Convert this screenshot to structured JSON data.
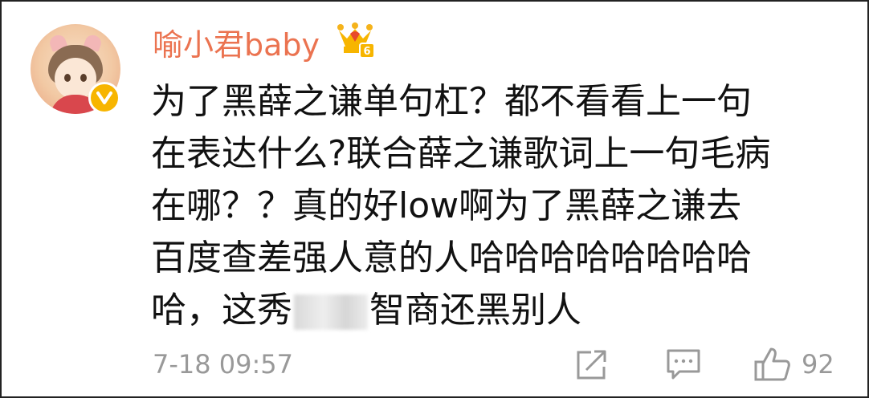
{
  "comment": {
    "username": "喻小君baby",
    "vip_level_badge": "crown-vip-icon",
    "lines": [
      "为了黑薛之谦单句杠？都不看看上一句",
      "在表达什么?联合薛之谦歌词上一句毛病",
      "在哪？？真的好low啊为了黑薛之谦去",
      "百度查差强人意的人哈哈哈哈哈哈哈哈",
      "哈，这秀",
      "智商还黑别人"
    ],
    "timestamp": "7-18 09:57",
    "like_count": "92"
  },
  "colors": {
    "username": "#eb7350",
    "text": "#111111",
    "meta": "#999999",
    "verified": "#f7b500"
  }
}
